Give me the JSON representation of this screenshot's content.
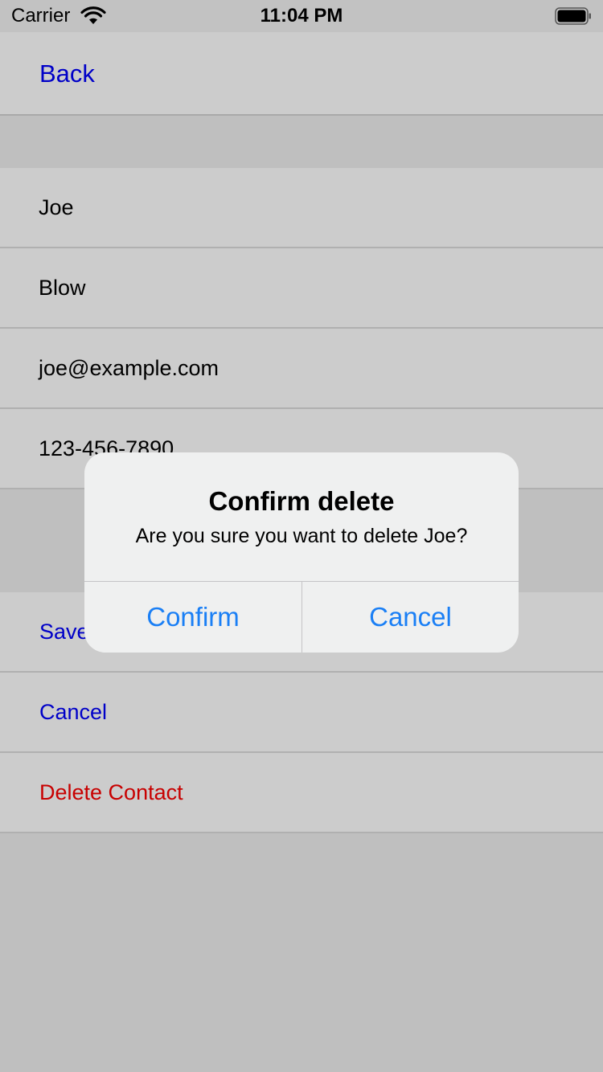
{
  "status_bar": {
    "carrier": "Carrier",
    "time": "11:04 PM",
    "wifi_icon": "wifi-icon",
    "battery_icon": "battery-icon"
  },
  "nav": {
    "back_label": "Back"
  },
  "contact": {
    "first_name": "Joe",
    "last_name": "Blow",
    "email": "joe@example.com",
    "phone": "123-456-7890"
  },
  "actions": {
    "save_label": "Save",
    "cancel_label": "Cancel",
    "delete_label": "Delete Contact"
  },
  "alert": {
    "title": "Confirm delete",
    "message": "Are you sure you want to delete Joe?",
    "confirm_label": "Confirm",
    "cancel_label": "Cancel"
  },
  "colors": {
    "link": "#0000c8",
    "destructive": "#c80000",
    "alert_button": "#1a7ff5"
  }
}
